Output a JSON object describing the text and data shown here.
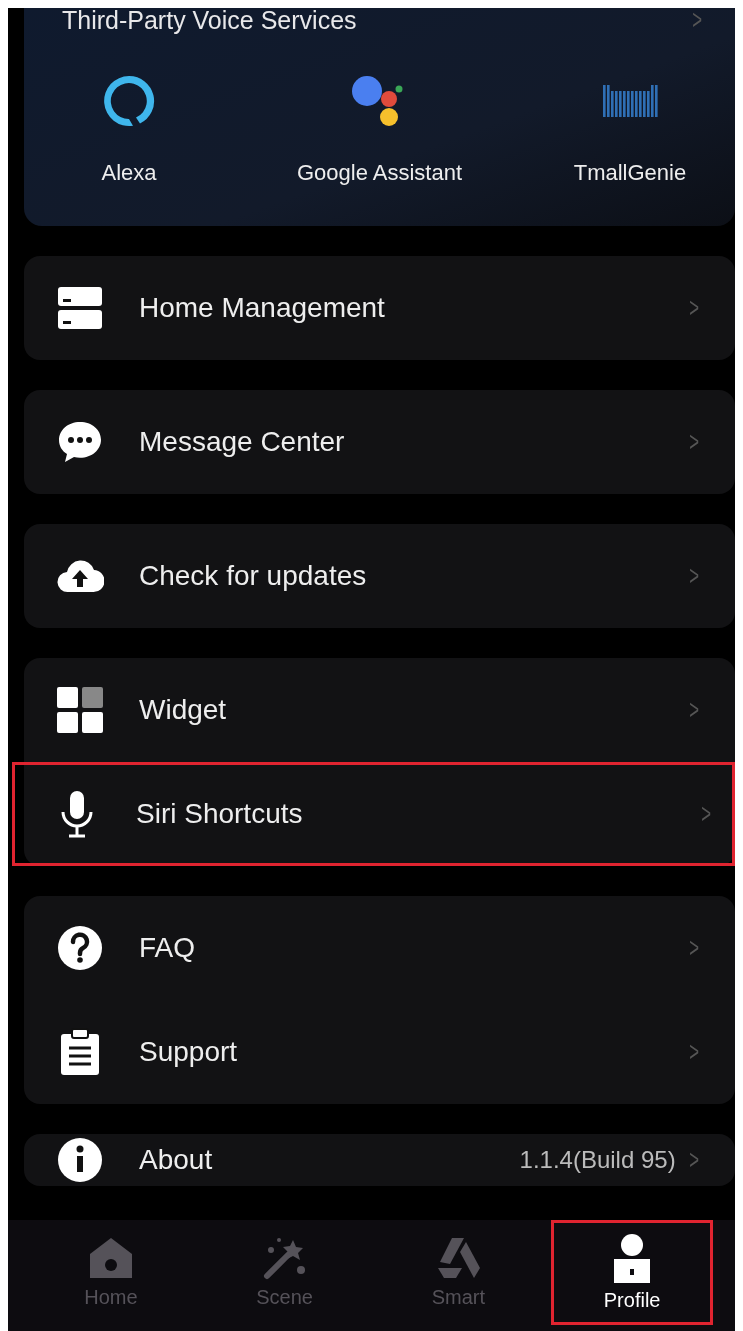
{
  "voice_services": {
    "title": "Third-Party Voice Services",
    "chevron": ">",
    "services": [
      {
        "kind": "alexa",
        "name": "Alexa"
      },
      {
        "kind": "google",
        "name": "Google Assistant"
      },
      {
        "kind": "tmall",
        "name": "TmallGenie"
      }
    ]
  },
  "groups": [
    {
      "items": [
        {
          "kind": "home",
          "label": "Home Management",
          "chevron": ">",
          "highlighted": false
        }
      ]
    },
    {
      "items": [
        {
          "kind": "message",
          "label": "Message Center",
          "chevron": ">",
          "highlighted": false
        }
      ]
    },
    {
      "items": [
        {
          "kind": "update",
          "label": "Check for updates",
          "chevron": ">",
          "highlighted": false
        }
      ]
    },
    {
      "items": [
        {
          "kind": "widget",
          "label": "Widget",
          "chevron": ">",
          "highlighted": false
        },
        {
          "kind": "mic",
          "label": "Siri Shortcuts",
          "chevron": ">",
          "highlighted": true
        }
      ]
    },
    {
      "items": [
        {
          "kind": "faq",
          "label": "FAQ",
          "chevron": ">",
          "highlighted": false
        },
        {
          "kind": "support",
          "label": "Support",
          "chevron": ">",
          "highlighted": false
        }
      ]
    },
    {
      "items": [
        {
          "kind": "info",
          "label": "About",
          "value": "1.1.4(Build 95)",
          "chevron": ">",
          "highlighted": false
        }
      ]
    }
  ],
  "tab_bar": [
    {
      "kind": "home",
      "label": "Home",
      "selected": false,
      "highlighted": false
    },
    {
      "kind": "scene",
      "label": "Scene",
      "selected": false,
      "highlighted": false
    },
    {
      "kind": "smart",
      "label": "Smart",
      "selected": false,
      "highlighted": false
    },
    {
      "kind": "profile",
      "label": "Profile",
      "selected": true,
      "highlighted": true
    }
  ]
}
